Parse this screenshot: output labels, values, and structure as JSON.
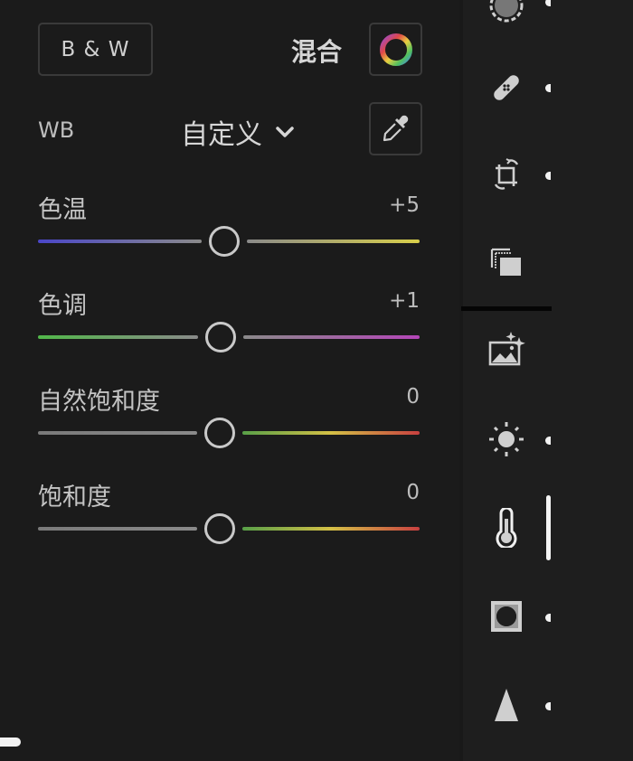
{
  "header": {
    "bw_button_label": "B & W",
    "mix_label": "混合"
  },
  "white_balance": {
    "label": "WB",
    "selected": "自定义"
  },
  "sliders": [
    {
      "label": "色温",
      "value_text": "+5",
      "value": 5,
      "min": -100,
      "max": 100,
      "gradient_left": [
        "#4a46c8",
        "#8a8a8a"
      ],
      "gradient_right": [
        "#8a8a8a",
        "#d8cf4a"
      ]
    },
    {
      "label": "色调",
      "value_text": "+1",
      "value": 1,
      "min": -100,
      "max": 100,
      "gradient_left": [
        "#52b84a",
        "#8a8a8a"
      ],
      "gradient_right": [
        "#8a8a8a",
        "#b446b8"
      ]
    },
    {
      "label": "自然饱和度",
      "value_text": "0",
      "value": 0,
      "min": -100,
      "max": 100,
      "gradient_left": [
        "#7a7a7a",
        "#8a8a8a"
      ],
      "gradient_right": [
        "#58a048",
        "#d4c046",
        "#c84040"
      ]
    },
    {
      "label": "饱和度",
      "value_text": "0",
      "value": 0,
      "min": -100,
      "max": 100,
      "gradient_left": [
        "#7a7a7a",
        "#8a8a8a"
      ],
      "gradient_right": [
        "#58a048",
        "#d4c046",
        "#c84040"
      ]
    }
  ],
  "rail": {
    "items": [
      {
        "name": "masking-icon",
        "has_dot": true
      },
      {
        "name": "healing-bandage-icon",
        "has_dot": true
      },
      {
        "name": "crop-rotate-icon",
        "has_dot": true
      },
      {
        "name": "versions-icon",
        "has_dot": false
      },
      {
        "name": "auto-enhance-icon",
        "has_dot": false
      },
      {
        "name": "light-sun-icon",
        "has_dot": true
      },
      {
        "name": "color-thermometer-icon",
        "active": true
      },
      {
        "name": "effects-vignette-icon",
        "has_dot": true
      },
      {
        "name": "detail-triangle-icon",
        "has_dot": true
      }
    ]
  }
}
